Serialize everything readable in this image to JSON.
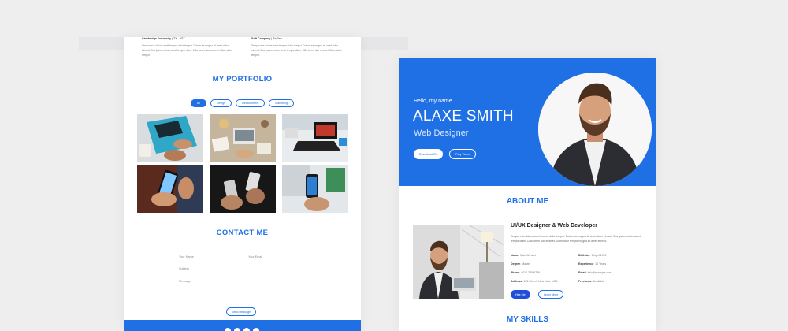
{
  "left_page": {
    "experience": [
      {
        "org": "Cambridge University",
        "dates": "2X - 3GT",
        "text": "Tempor eos dolore amet tempor dolor tempor. Dolore ea magna sit amet dolor eirmod. Eos ipsum rebum amet tempor diam. Clita lorem duo et amet. Diam dolor tempor."
      },
      {
        "org": "Soft Company",
        "dates": "Zsollen",
        "text": "Tempor eos dolore amet tempor dolor tempor. Dolore ea magna sit amet dolor eirmod. Eos ipsum rebum amet tempor diam. Clita lorem duo et amet. Diam dolor tempor."
      }
    ],
    "portfolio_title": "MY PORTFOLIO",
    "filters": [
      "All",
      "Design",
      "Development",
      "Marketing"
    ],
    "contact_title": "CONTACT ME",
    "contact_fields": {
      "name": "Your Name",
      "email": "Your Email",
      "subject": "Subject",
      "message": "Message"
    },
    "send_button": "Send Message"
  },
  "right_page": {
    "hello": "Hello, my name",
    "name": "ALAXE SMITH",
    "role": "Web Designer",
    "download_btn": "Download CV",
    "play_btn": "Play Video",
    "about_title": "ABOUT ME",
    "about_role": "UI/UX Designer & Web Developer",
    "about_text": "Tempor eos dolore amet tempor dolor tempor. Dolore ea magna sit amet dolor eirmod. Eos ipsum rebum amet tempor diam. Clita lorem duo et amet. Diam dolor tempor magna sit amet eirmod.",
    "info": {
      "name_label": "Name",
      "name_value": "Kate Winslet",
      "birthday_label": "Birthday",
      "birthday_value": "1 April 1990",
      "degree_label": "Degree",
      "degree_value": "Master",
      "experience_label": "Experience",
      "experience_value": "10 Years",
      "phone_label": "Phone",
      "phone_value": "+012 345 6789",
      "email_label": "Email",
      "email_value": "info@example.com",
      "address_label": "Address",
      "address_value": "123 Street, New York, USA",
      "freelance_label": "Freelance",
      "freelance_value": "Available"
    },
    "hire_btn": "Hire Me",
    "learn_btn": "Learn More",
    "skills_title": "MY SKILLS"
  },
  "colors": {
    "accent": "#1f6fe5",
    "background": "#efeeef"
  }
}
